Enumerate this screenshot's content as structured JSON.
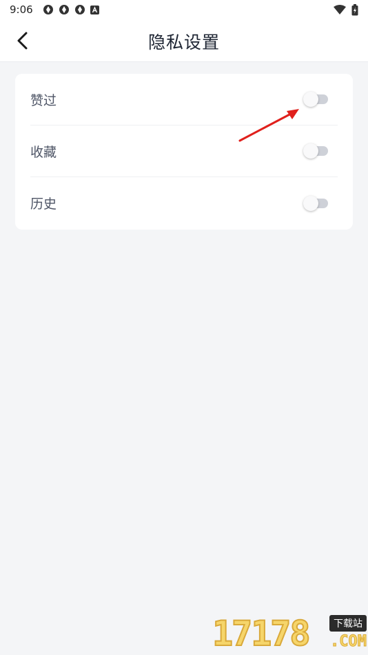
{
  "status_bar": {
    "time": "9:06",
    "notification_icons": [
      "aperture-icon",
      "aperture-icon",
      "aperture-icon",
      "a-box-icon"
    ],
    "right_icons": [
      "wifi-icon",
      "battery-charging-icon"
    ]
  },
  "header": {
    "back_icon": "chevron-left-icon",
    "title": "隐私设置"
  },
  "settings": {
    "items": [
      {
        "label": "赞过",
        "enabled": false
      },
      {
        "label": "收藏",
        "enabled": false
      },
      {
        "label": "历史",
        "enabled": false
      }
    ]
  },
  "annotation": {
    "arrow_color": "#e0201c"
  },
  "watermark": {
    "digits": "17178",
    "badge": "下载站",
    "domain": ".COM"
  },
  "colors": {
    "background": "#f4f5f7",
    "card": "#ffffff",
    "toggle_off_track": "#ced1d8",
    "title": "#1e2533",
    "label": "#4e5566"
  }
}
